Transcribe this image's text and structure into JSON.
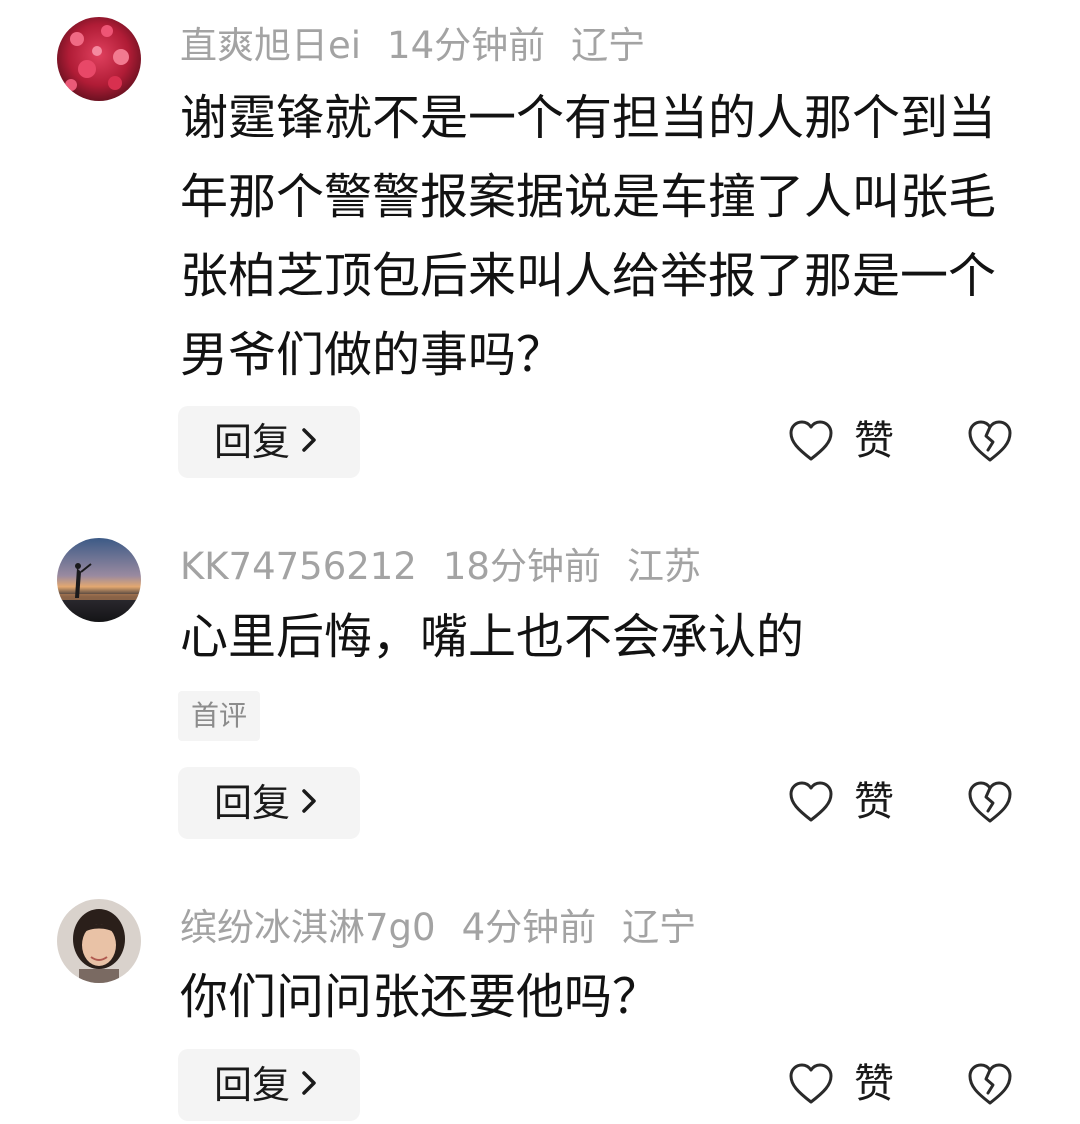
{
  "comments": [
    {
      "username": "直爽旭日ei",
      "time": "14分钟前",
      "location": "辽宁",
      "text": "谢霆锋就不是一个有担当的人那个到当年那个警警报案据说是车撞了人叫张毛张柏芝顶包后来叫人给举报了那是一个男爷们做的事吗？",
      "reply_label": "回复",
      "like_label": "赞"
    },
    {
      "username": "KK74756212",
      "time": "18分钟前",
      "location": "江苏",
      "text": "心里后悔，嘴上也不会承认的",
      "badge": "首评",
      "reply_label": "回复",
      "like_label": "赞"
    },
    {
      "username": "缤纷冰淇淋7g0",
      "time": "4分钟前",
      "location": "辽宁",
      "text": "你们问问张还要他吗？",
      "reply_label": "回复",
      "like_label": "赞"
    }
  ],
  "icons": {
    "reply_chevron": "chevron-right-icon",
    "like": "heart-outline-icon",
    "dislike": "broken-heart-icon"
  },
  "colors": {
    "meta_text": "#a3a3a3",
    "button_bg": "#f4f4f4",
    "body_text": "#121212"
  }
}
